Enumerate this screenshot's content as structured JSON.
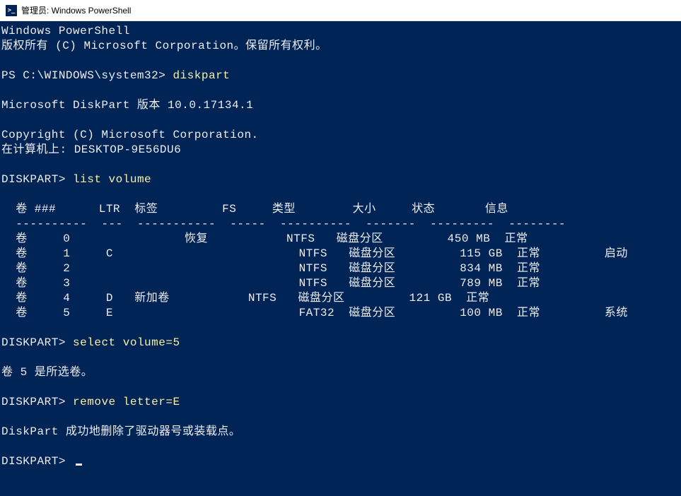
{
  "window": {
    "title": "管理员: Windows PowerShell",
    "icon_label": ">_"
  },
  "banner": {
    "line1": "Windows PowerShell",
    "line2": "版权所有 (C) Microsoft Corporation。保留所有权利。"
  },
  "prompt1": {
    "ps": "PS C:\\WINDOWS\\system32>",
    "cmd": "diskpart"
  },
  "diskpart_banner": {
    "version": "Microsoft DiskPart 版本 10.0.17134.1",
    "copyright": "Copyright (C) Microsoft Corporation.",
    "computer": "在计算机上: DESKTOP-9E56DU6"
  },
  "prompt2": {
    "ps": "DISKPART>",
    "cmd": "list volume"
  },
  "table": {
    "header": "  卷 ###      LTR  标签         FS     类型        大小     状态       信息",
    "divider": "  ----------  ---  -----------  -----  ----------  -------  ---------  --------",
    "rows": [
      "  卷     0                恢复           NTFS   磁盘分区         450 MB  正常",
      "  卷     1     C                          NTFS   磁盘分区         115 GB  正常         启动",
      "  卷     2                                NTFS   磁盘分区         834 MB  正常",
      "  卷     3                                NTFS   磁盘分区         789 MB  正常",
      "  卷     4     D   新加卷           NTFS   磁盘分区         121 GB  正常",
      "  卷     5     E                          FAT32  磁盘分区         100 MB  正常         系统"
    ]
  },
  "prompt3": {
    "ps": "DISKPART>",
    "cmd": "select volume=5"
  },
  "msg_selected": "卷 5 是所选卷。",
  "prompt4": {
    "ps": "DISKPART>",
    "cmd": "remove letter=E"
  },
  "msg_removed": "DiskPart 成功地删除了驱动器号或装载点。",
  "prompt5": {
    "ps": "DISKPART>"
  },
  "volumes_structured": [
    {
      "num": 0,
      "ltr": "",
      "label": "恢复",
      "fs": "NTFS",
      "type": "磁盘分区",
      "size": "450 MB",
      "status": "正常",
      "info": ""
    },
    {
      "num": 1,
      "ltr": "C",
      "label": "",
      "fs": "NTFS",
      "type": "磁盘分区",
      "size": "115 GB",
      "status": "正常",
      "info": "启动"
    },
    {
      "num": 2,
      "ltr": "",
      "label": "",
      "fs": "NTFS",
      "type": "磁盘分区",
      "size": "834 MB",
      "status": "正常",
      "info": ""
    },
    {
      "num": 3,
      "ltr": "",
      "label": "",
      "fs": "NTFS",
      "type": "磁盘分区",
      "size": "789 MB",
      "status": "正常",
      "info": ""
    },
    {
      "num": 4,
      "ltr": "D",
      "label": "新加卷",
      "fs": "NTFS",
      "type": "磁盘分区",
      "size": "121 GB",
      "status": "正常",
      "info": ""
    },
    {
      "num": 5,
      "ltr": "E",
      "label": "",
      "fs": "FAT32",
      "type": "磁盘分区",
      "size": "100 MB",
      "status": "正常",
      "info": "系统"
    }
  ]
}
